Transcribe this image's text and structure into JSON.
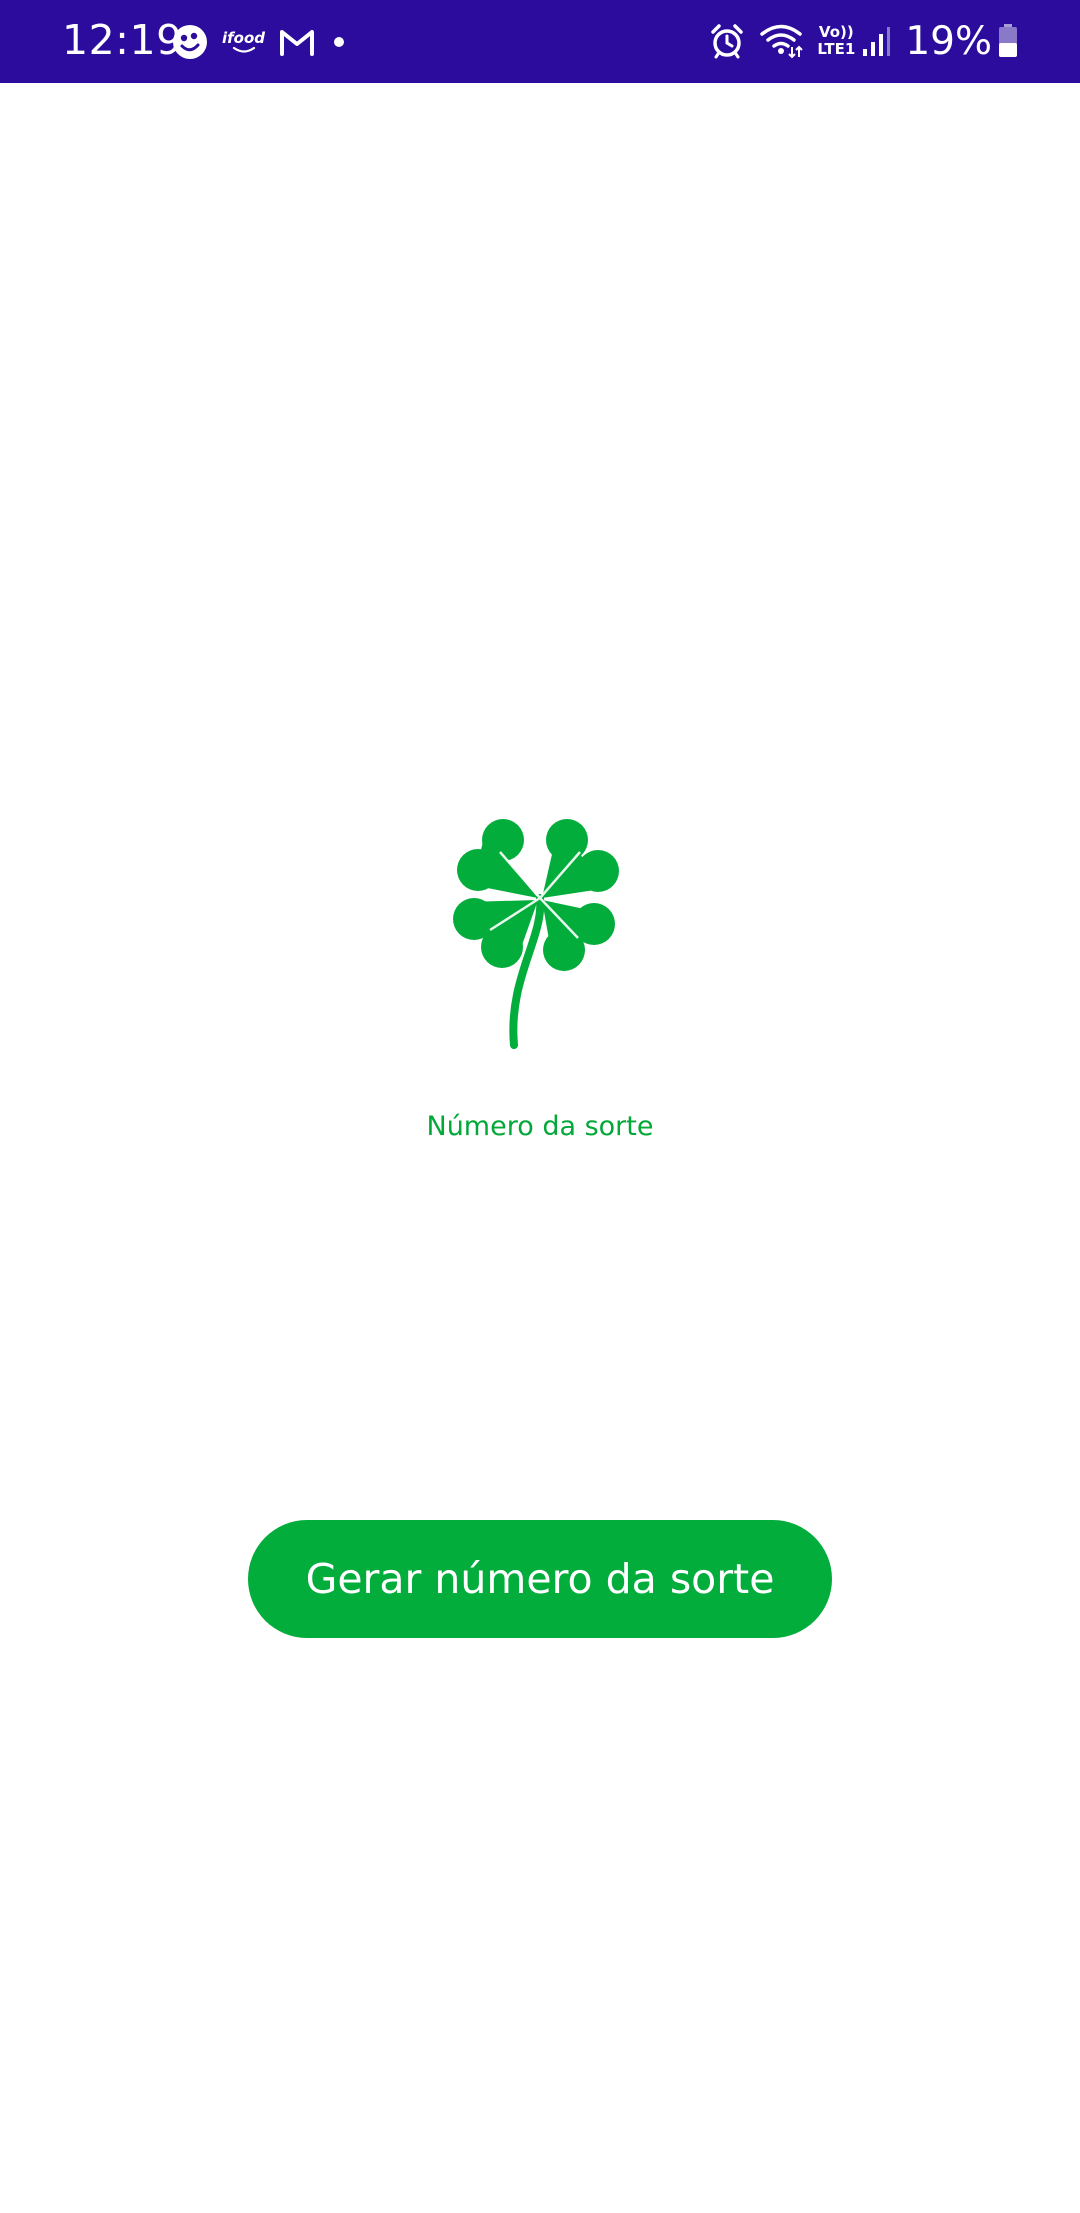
{
  "status_bar": {
    "time": "12:19",
    "notification_icons": [
      "face-icon",
      "ifood-icon",
      "gmail-icon",
      "dot-icon"
    ],
    "ifood_label": "ifood",
    "volte_top": "Vo))",
    "volte_bottom": "LTE1",
    "battery_percent": "19%",
    "background_color": "#2b0c9c"
  },
  "main": {
    "icon": "four-leaf-clover-icon",
    "label": "Número da sorte",
    "button_label": "Gerar número da sorte",
    "accent_color": "#02ad3b"
  }
}
